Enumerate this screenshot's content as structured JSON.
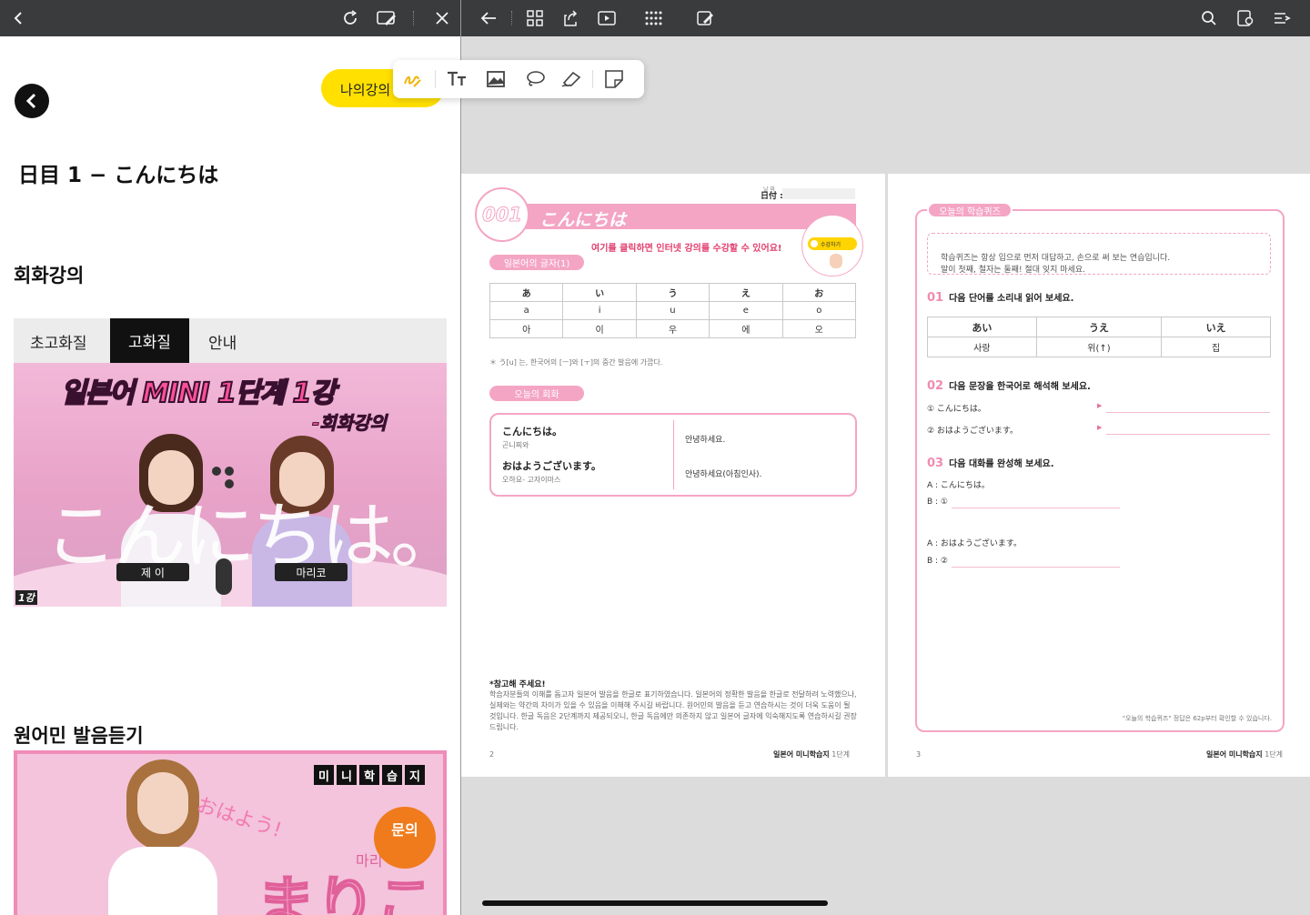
{
  "left": {
    "chapter_title": "日目 1 − こんにちは",
    "my_lecture_label": "나의강의",
    "section_conversation": "회화강의",
    "quality_tabs": [
      "초고화질",
      "고화질",
      "안내"
    ],
    "video1": {
      "title": "일본어 MINI 1단계 1강",
      "subtitle": "-회화강의",
      "big_text": "こんにちは。",
      "name_left": "제 이",
      "name_right": "마리코",
      "corner": "1강"
    },
    "section_native": "원어민 발음듣기",
    "video2": {
      "brand": [
        "미",
        "니",
        "학",
        "습",
        "지"
      ],
      "greeting": "おはよう!",
      "big_text": "まりこ",
      "inquiry": "문의",
      "partial_name": "마리"
    }
  },
  "toolbar": {
    "tools": [
      "pen-icon",
      "text-icon",
      "image-icon",
      "lasso-icon",
      "eraser-icon",
      "sticky-note-icon"
    ]
  },
  "page2": {
    "date_label": "日付 :",
    "date_small": "날 짜",
    "lesson_no": "001",
    "lesson_title": "こんにちは",
    "click_hint": "여기를 클릭하면 인터넷 강의를 수강할 수 있어요!",
    "watch_button": "수강하기",
    "section_kana": "일본어의 글자(1)",
    "kana_rows": [
      [
        "あ",
        "い",
        "う",
        "え",
        "お"
      ],
      [
        "a",
        "i",
        "u",
        "e",
        "o"
      ],
      [
        "아",
        "이",
        "우",
        "에",
        "오"
      ]
    ],
    "kana_note": "＊  う[u] 는, 한국어의 [ㅡ]와 [ㅜ]의 중간 발음에 가깝다.",
    "section_dialogue": "오늘의 회화",
    "dialogue": [
      {
        "jp": "こんにちは。",
        "reading": "곤니찌와",
        "kr": "안녕하세요."
      },
      {
        "jp": "おはようございます。",
        "reading": "오하요- 고자이마스",
        "kr": "안녕하세요(아침인사)."
      }
    ],
    "note_title": "*참고해 주세요!",
    "note_body": "학습자분들의 이해를 돕고자 일본어 발음을 한글로 표기하였습니다. 일본어의 정확한 발음을 한글로 전달하려 노력했으나, 실제와는 약간의 차이가 있을 수 있음을 이해해 주시길 바랍니다. 원어민의 발음을 듣고 연습하시는 것이 더욱 도움이 될 것입니다. 한글 독음은 2단계까지 제공되오니, 한글 독음에만 의존하지 않고 일본어 글자에 익숙해지도록 연습하시길 권장드립니다.",
    "page_no": "2",
    "footer_book": "일본어 미니학습지",
    "footer_level": "1단계"
  },
  "page3": {
    "quiz_tab": "오늘의 학습퀴즈",
    "intro": "학습퀴즈는 항상 입으로 먼저 대답하고, 손으로 써 보는 연습입니다.\n말이 첫째, 철자는 둘째! 절대 잊지 마세요.",
    "q1_no": "01",
    "q1_text": "다음 단어를 소리내 읽어 보세요.",
    "q1_table": [
      [
        "あい",
        "うえ",
        "いえ"
      ],
      [
        "사랑",
        "위(↑)",
        "집"
      ]
    ],
    "q2_no": "02",
    "q2_text": "다음 문장을 한국어로 해석해 보세요.",
    "q2_items": [
      "① こんにちは。",
      "② おはようございます。"
    ],
    "q3_no": "03",
    "q3_text": "다음 대화를 완성해 보세요.",
    "q3_items": [
      {
        "a": "A : こんにちは。",
        "b": "B : ①"
      },
      {
        "a": "A : おはようございます。",
        "b": "B : ②"
      }
    ],
    "answer_note": "\"오늘의 학습퀴즈\" 정답은 62p부터 확인할 수 있습니다.",
    "page_no": "3",
    "footer_book": "일본어 미니학습지",
    "footer_level": "1단계"
  }
}
